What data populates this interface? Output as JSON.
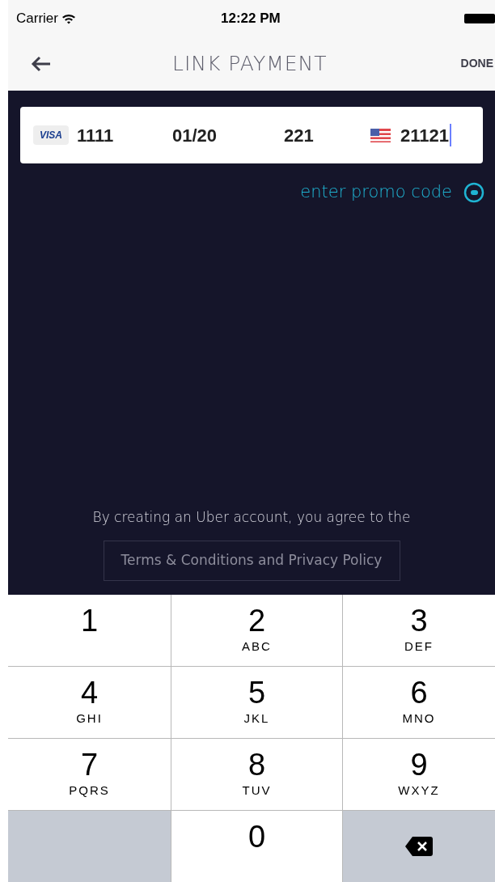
{
  "status_bar": {
    "carrier": "Carrier",
    "time": "12:22 PM"
  },
  "nav": {
    "title": "LINK PAYMENT",
    "done": "DONE"
  },
  "card": {
    "brand": "VISA",
    "number": "1111",
    "expiry": "01/20",
    "cvv": "221",
    "zip": "21121",
    "zip_focused": true
  },
  "promo": {
    "label": "enter promo code"
  },
  "legal": {
    "text": "By creating an Uber account, you agree to the",
    "link": "Terms & Conditions and Privacy Policy"
  },
  "keypad": [
    {
      "kind": "digit",
      "digit": "1"
    },
    {
      "kind": "digit",
      "digit": "2",
      "letters": "ABC"
    },
    {
      "kind": "digit",
      "digit": "3",
      "letters": "DEF"
    },
    {
      "kind": "digit",
      "digit": "4",
      "letters": "GHI"
    },
    {
      "kind": "digit",
      "digit": "5",
      "letters": "JKL"
    },
    {
      "kind": "digit",
      "digit": "6",
      "letters": "MNO"
    },
    {
      "kind": "digit",
      "digit": "7",
      "letters": "PQRS"
    },
    {
      "kind": "digit",
      "digit": "8",
      "letters": "TUV"
    },
    {
      "kind": "digit",
      "digit": "9",
      "letters": "WXYZ"
    },
    {
      "kind": "blank"
    },
    {
      "kind": "digit",
      "digit": "0"
    },
    {
      "kind": "delete"
    }
  ]
}
